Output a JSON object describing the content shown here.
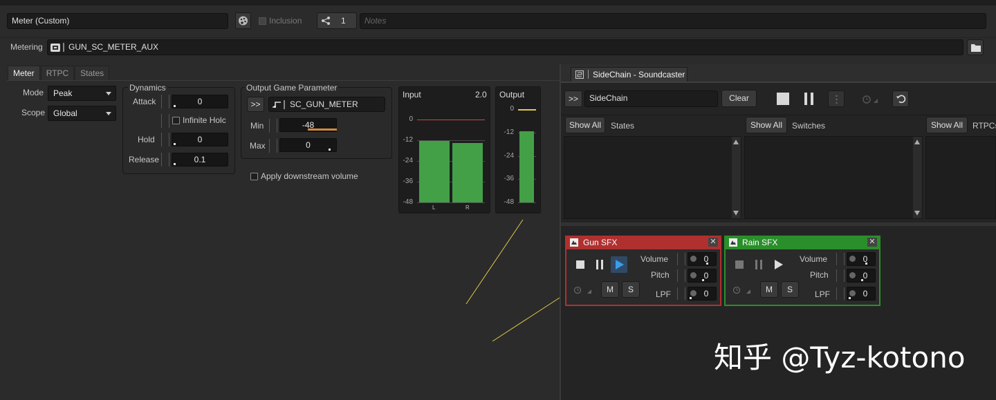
{
  "header": {
    "object_name": "Meter (Custom)",
    "inclusion_label": "Inclusion",
    "share_count": "1",
    "notes_placeholder": "Notes"
  },
  "metering": {
    "label": "Metering",
    "value": "GUN_SC_METER_AUX"
  },
  "tabs": [
    "Meter",
    "RTPC",
    "States"
  ],
  "meter": {
    "mode_label": "Mode",
    "mode_value": "Peak",
    "scope_label": "Scope",
    "scope_value": "Global",
    "dynamics": {
      "title": "Dynamics",
      "attack_label": "Attack",
      "attack_value": "0",
      "infinite_hold_label": "Infinite Holc",
      "hold_label": "Hold",
      "hold_value": "0",
      "release_label": "Release",
      "release_value": "0.1"
    },
    "output_param": {
      "title": "Output Game Parameter",
      "expand": ">>",
      "value": "SC_GUN_METER",
      "min_label": "Min",
      "min_value": "-48",
      "max_label": "Max",
      "max_value": "0"
    },
    "apply_downstream_label": "Apply downstream volume",
    "input_meter": {
      "title": "Input",
      "gain": "2.0",
      "ticks": [
        "0",
        "-12",
        "-24",
        "-36",
        "-48"
      ],
      "channels": [
        "L",
        "R"
      ],
      "levels": [
        -12.5,
        -13.5
      ]
    },
    "output_meter": {
      "title": "Output",
      "ticks": [
        "0",
        "-12",
        "-24",
        "-36",
        "-48"
      ],
      "level": -11.5
    }
  },
  "soundcaster": {
    "window_title": "SideChain - Soundcaster",
    "expand": ">>",
    "session_name": "SideChain",
    "clear_label": "Clear",
    "columns": [
      {
        "show_all": "Show All",
        "title": "States"
      },
      {
        "show_all": "Show All",
        "title": "Switches"
      },
      {
        "show_all": "Show All",
        "title": "RTPCs"
      }
    ],
    "players": [
      {
        "name": "Gun SFX",
        "color": "#b03030",
        "volume_label": "Volume",
        "volume_value": "0",
        "pitch_label": "Pitch",
        "pitch_value": "0",
        "lpf_label": "LPF",
        "lpf_value": "0",
        "mute": "M",
        "solo": "S"
      },
      {
        "name": "Rain SFX",
        "color": "#2a8f2a",
        "volume_label": "Volume",
        "volume_value": "0",
        "pitch_label": "Pitch",
        "pitch_value": "0",
        "lpf_label": "LPF",
        "lpf_value": "0",
        "mute": "M",
        "solo": "S"
      }
    ]
  },
  "watermark": "知乎 @Tyz-kotono",
  "colors": {
    "meter_green": "#43a047",
    "red_line": "#d84040",
    "yellow_line": "#e6c84a",
    "play_blue": "#3a9de8"
  }
}
